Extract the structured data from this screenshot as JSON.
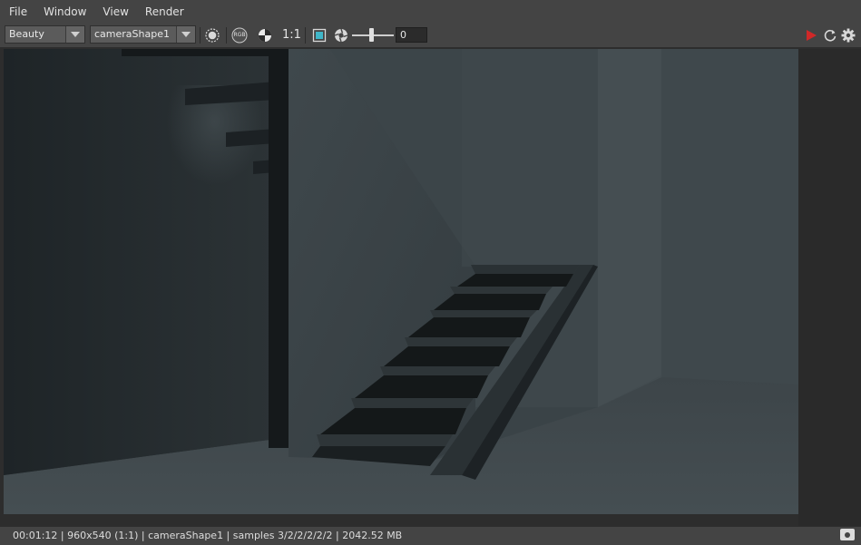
{
  "menu": {
    "items": [
      {
        "label": "File"
      },
      {
        "label": "Window"
      },
      {
        "label": "View"
      },
      {
        "label": "Render"
      }
    ]
  },
  "toolbar": {
    "aov_select": "Beauty",
    "camera_select": "cameraShape1",
    "rgb_label": "RGB",
    "ratio_label": "1:1",
    "exposure_value": "0",
    "icons": [
      "background-toggle-icon",
      "rgb-channel-icon",
      "alpha-split-icon",
      "region-icon",
      "exposure-icon",
      "render-play-icon",
      "refresh-icon",
      "settings-gear-icon"
    ]
  },
  "colors": {
    "accent_play": "#d02828",
    "region_icon": "#3fb6c8"
  },
  "status": {
    "text": "00:01:12 | 960x540 (1:1) | cameraShape1  | samples 3/2/2/2/2/2 | 2042.52 MB"
  }
}
